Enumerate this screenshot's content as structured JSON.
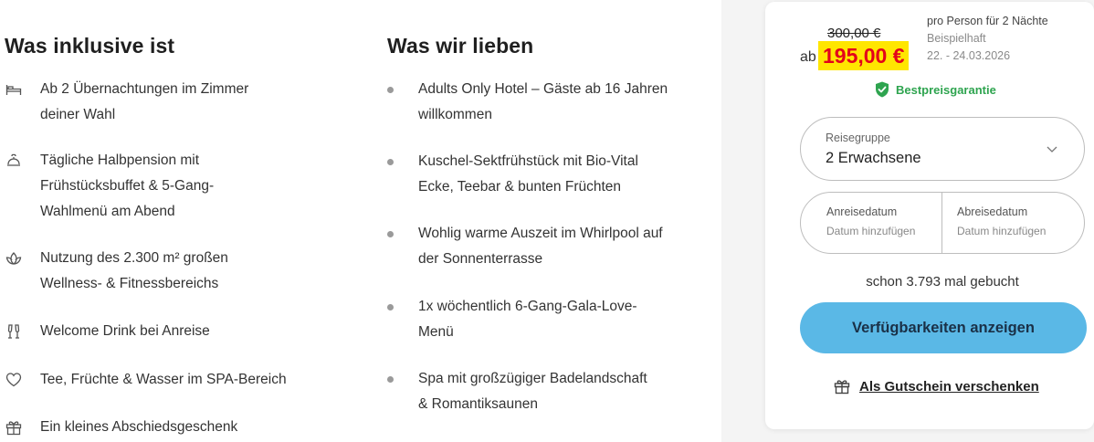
{
  "inclusive": {
    "title": "Was inklusive ist",
    "items": [
      {
        "icon": "bed-icon",
        "lines": [
          "Ab 2 Übernachtungen im Zimmer",
          "deiner Wahl"
        ]
      },
      {
        "icon": "food-icon",
        "lines": [
          "Tägliche Halbpension mit",
          "Frühstücksbuffet & 5-Gang-",
          "Wahlmenü am Abend"
        ]
      },
      {
        "icon": "lotus-icon",
        "lines": [
          "Nutzung des 2.300 m² großen",
          "Wellness- & Fitnessbereichs"
        ]
      },
      {
        "icon": "champagne-icon",
        "lines": [
          "Welcome Drink bei Anreise"
        ]
      },
      {
        "icon": "heart-icon",
        "lines": [
          "Tee, Früchte & Wasser im SPA-Bereich"
        ]
      },
      {
        "icon": "gift-icon",
        "lines": [
          "Ein kleines Abschiedsgeschenk"
        ]
      }
    ]
  },
  "love": {
    "title": "Was wir lieben",
    "items": [
      {
        "lines": [
          "Adults Only Hotel – Gäste ab 16 Jahren",
          "willkommen"
        ]
      },
      {
        "lines": [
          "Kuschel-Sektfrühstück mit Bio-Vital",
          "Ecke, Teebar & bunten Früchten"
        ]
      },
      {
        "lines": [
          "Wohlig warme Auszeit im Whirlpool auf",
          "der Sonnenterrasse"
        ]
      },
      {
        "lines": [
          "1x wöchentlich 6-Gang-Gala-Love-",
          "Menü"
        ]
      },
      {
        "lines": [
          "Spa mit großzügiger Badelandschaft",
          "& Romantiksaunen"
        ]
      }
    ]
  },
  "booking": {
    "old_price": "300,00 €",
    "ab": "ab",
    "new_price": "195,00 €",
    "meta_line1": "pro Person für 2 Nächte",
    "meta_line2": "Beispielhaft",
    "meta_line3": "22. - 24.03.2026",
    "best_price": "Bestpreisgarantie",
    "group_label": "Reisegruppe",
    "group_value": "2 Erwachsene",
    "arrival_label": "Anreisedatum",
    "arrival_placeholder": "Datum hinzufügen",
    "departure_label": "Abreisedatum",
    "departure_placeholder": "Datum hinzufügen",
    "booked_text": "schon 3.793 mal gebucht",
    "cta_label": "Verfügbarkeiten anzeigen",
    "voucher_label": "Als Gutschein verschenken"
  },
  "colors": {
    "price_red": "#e3001b",
    "price_highlight": "#ffe600",
    "best_price_green": "#2ea44f",
    "cta_blue": "#5ab8e6"
  }
}
